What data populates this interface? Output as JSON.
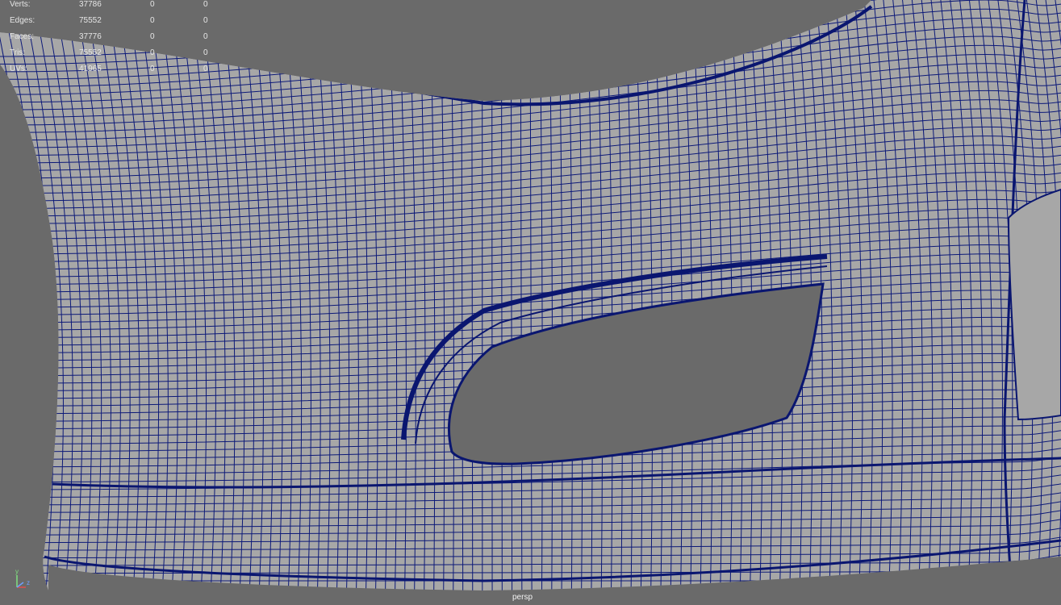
{
  "viewport": {
    "camera": "persp",
    "background": "#6a6a6a",
    "surface_color": "#a7a7a7",
    "wire_color": "#0c1978"
  },
  "heads_up": {
    "rows": [
      {
        "label": "Verts:",
        "total": "37786",
        "selected": "0",
        "component": "0"
      },
      {
        "label": "Edges:",
        "total": "75552",
        "selected": "0",
        "component": "0"
      },
      {
        "label": "Faces:",
        "total": "37776",
        "selected": "0",
        "component": "0"
      },
      {
        "label": "Tris:",
        "total": "75552",
        "selected": "0",
        "component": "0"
      },
      {
        "label": "UVs:",
        "total": "41965",
        "selected": "0",
        "component": "0"
      }
    ]
  },
  "axis_gizmo": {
    "y": "y",
    "z": "z"
  }
}
